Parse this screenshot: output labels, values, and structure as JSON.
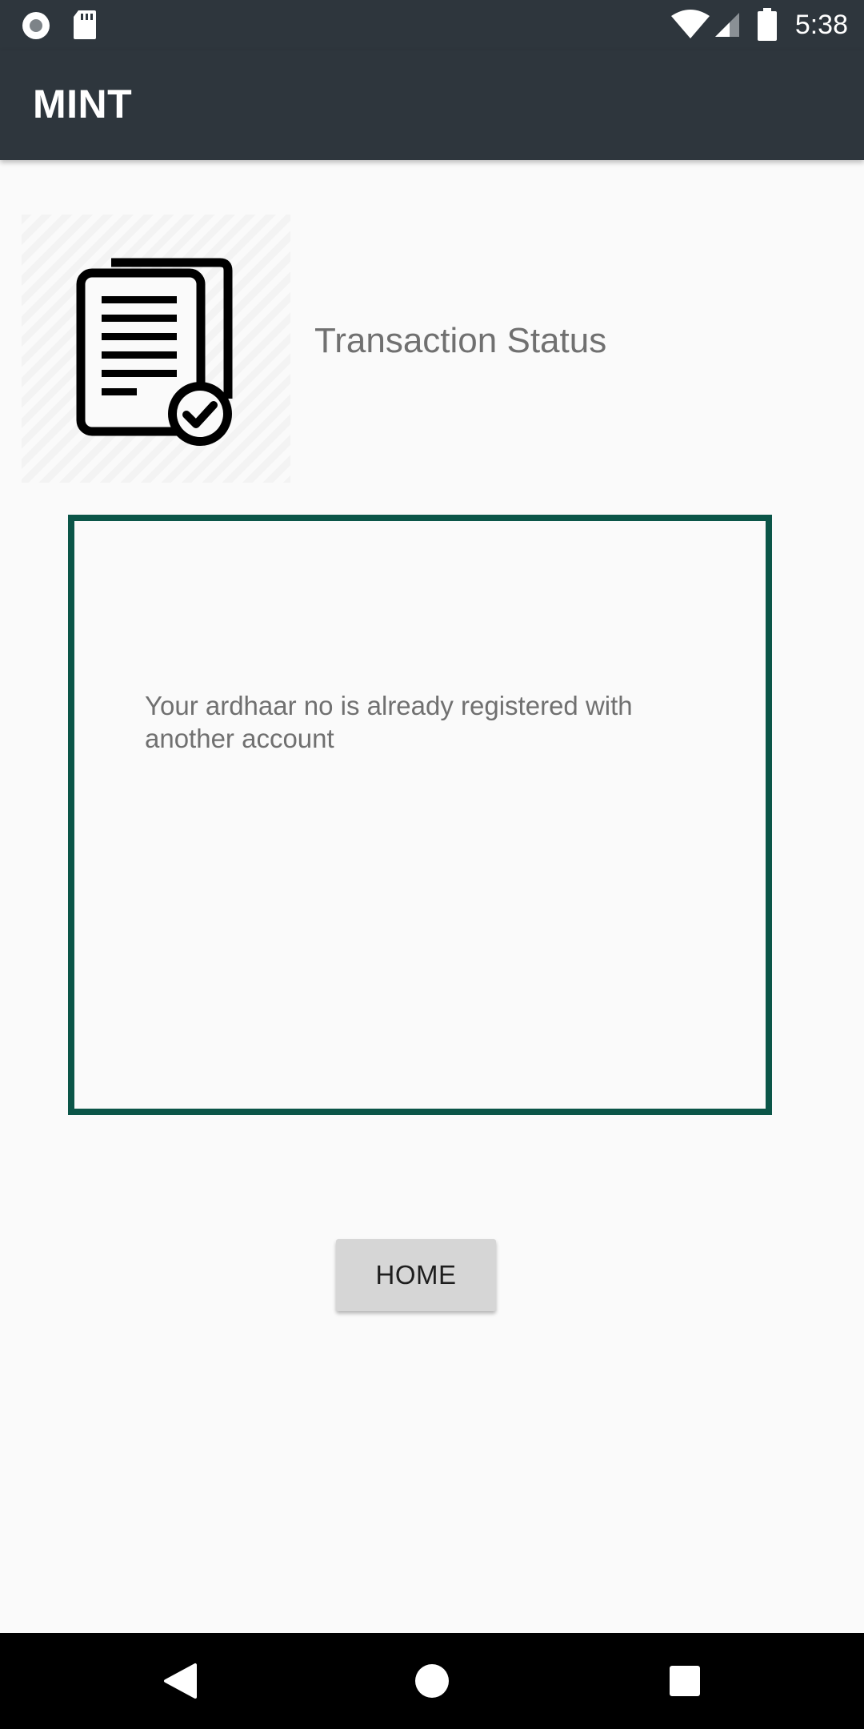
{
  "status_bar": {
    "time": "5:38",
    "left_icons": [
      "record-icon",
      "sd-card-icon"
    ],
    "right_icons": [
      "wifi-icon",
      "cell-signal-icon",
      "battery-icon"
    ]
  },
  "app_bar": {
    "title": "MINT",
    "background_color": "#2e363d"
  },
  "header": {
    "image_icon": "document-check-icon",
    "title": "Transaction Status"
  },
  "message": {
    "text": "Your ardhaar no is already registered with another account",
    "border_color": "#0b5548"
  },
  "home_button": {
    "label": "HOME"
  },
  "nav_bar": {
    "buttons": [
      "back-icon",
      "home-circle-icon",
      "recents-icon"
    ]
  }
}
